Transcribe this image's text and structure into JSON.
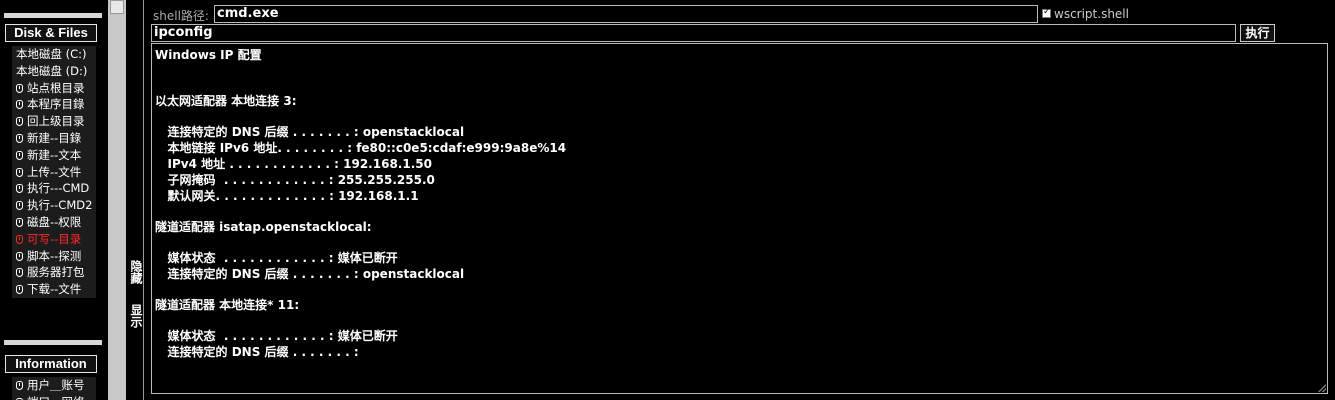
{
  "sidebar": {
    "disk_section": "Disk & Files",
    "disk_items": [
      {
        "label": "本地磁盘 (C:)",
        "icon": "",
        "style": ""
      },
      {
        "label": "本地磁盘 (D:)",
        "icon": "",
        "style": ""
      },
      {
        "label": "站点根目录",
        "icon": "mouse-icon",
        "style": ""
      },
      {
        "label": "本程序目錄",
        "icon": "mouse-icon",
        "style": ""
      },
      {
        "label": "回上级目录",
        "icon": "mouse-icon",
        "style": ""
      },
      {
        "label": "新建--目錄",
        "icon": "mouse-icon",
        "style": ""
      },
      {
        "label": "新建--文本",
        "icon": "mouse-icon",
        "style": ""
      },
      {
        "label": "上传--文件",
        "icon": "mouse-icon",
        "style": ""
      },
      {
        "label": "执行---CMD",
        "icon": "mouse-icon",
        "style": ""
      },
      {
        "label": "执行--CMD2",
        "icon": "mouse-icon",
        "style": ""
      },
      {
        "label": "磁盘--权限",
        "icon": "mouse-icon",
        "style": ""
      },
      {
        "label": "可写--目录",
        "icon": "mouse-icon",
        "style": "red"
      },
      {
        "label": "脚本--探测",
        "icon": "mouse-icon",
        "style": ""
      },
      {
        "label": "服务器打包",
        "icon": "mouse-icon",
        "style": ""
      },
      {
        "label": "下载--文件",
        "icon": "mouse-icon",
        "style": ""
      }
    ],
    "info_section": "Information",
    "info_items": [
      {
        "label": "用户＿账号",
        "icon": "mouse-icon"
      },
      {
        "label": "端口＿网络",
        "icon": "mouse-icon"
      }
    ]
  },
  "toggles": {
    "hide": "隐藏",
    "show": "显示"
  },
  "main": {
    "shell_label": "shell路径:",
    "shell_value": "cmd.exe",
    "wscript_label": "wscript.shell",
    "wscript_checked": true,
    "command_value": "ipconfig",
    "exec_label": "执行",
    "output_lines": [
      "Windows IP 配置",
      "",
      "",
      "以太网适配器 本地连接 3:",
      "",
      "   连接特定的 DNS 后缀 . . . . . . . : openstacklocal",
      "   本地链接 IPv6 地址. . . . . . . . : fe80::c0e5:cdaf:e999:9a8e%14",
      "   IPv4 地址 . . . . . . . . . . . . : 192.168.1.50",
      "   子网掩码  . . . . . . . . . . . . : 255.255.255.0",
      "   默认网关. . . . . . . . . . . . . : 192.168.1.1",
      "",
      "隧道适配器 isatap.openstacklocal:",
      "",
      "   媒体状态  . . . . . . . . . . . . : 媒体已断开",
      "   连接特定的 DNS 后缀 . . . . . . . : openstacklocal",
      "",
      "隧道适配器 本地连接* 11:",
      "",
      "   媒体状态  . . . . . . . . . . . . : 媒体已断开",
      "   连接特定的 DNS 后缀 . . . . . . . :"
    ]
  }
}
